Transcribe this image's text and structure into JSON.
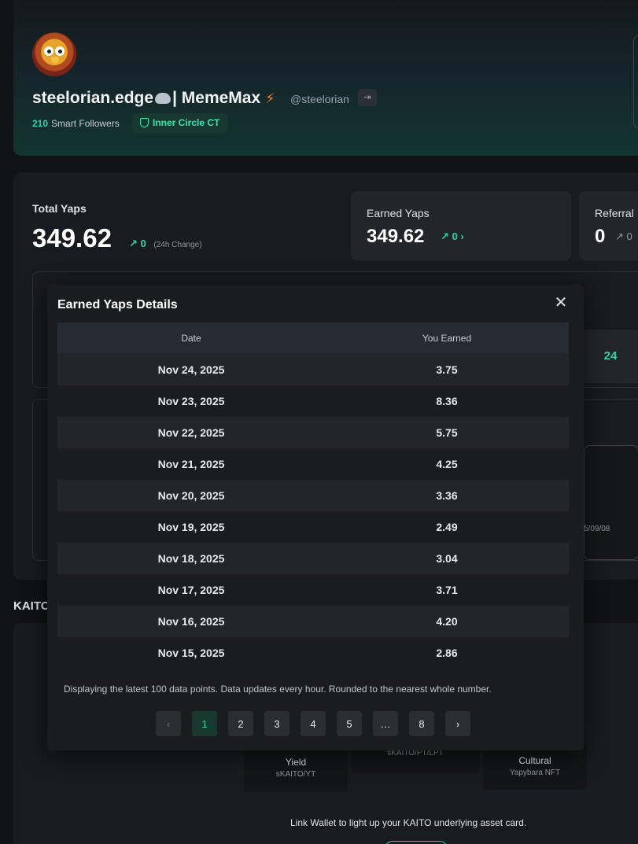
{
  "profile": {
    "display_name": "steelorian.edge",
    "name_suffix": "| MemeMax",
    "handle": "@steelorian",
    "smart_followers_count": "210",
    "smart_followers_label": "Smart Followers",
    "badge": "Inner Circle CT"
  },
  "stats": {
    "total_label": "Total Yaps",
    "total_value": "349.62",
    "total_change": "0",
    "total_change_note": "(24h Change)",
    "earned_label": "Earned Yaps",
    "earned_value": "349.62",
    "earned_change": "0",
    "referral_label": "Referral",
    "referral_value": "0",
    "referral_change": "0",
    "peek_number": "24",
    "peek_date": "5/09/08"
  },
  "kaito": {
    "section_label": "KAITO",
    "tiles": [
      {
        "title": "Yield",
        "subtitle": "sKAITO/YT"
      },
      {
        "title": "",
        "subtitle": "sKAITO/PT/LPT"
      },
      {
        "title": "Cultural",
        "subtitle": "Yapybara NFT"
      }
    ],
    "link_wallet_text": "Link Wallet to light up your KAITO underlying asset card."
  },
  "modal": {
    "title": "Earned Yaps Details",
    "columns": [
      "Date",
      "You Earned"
    ],
    "rows": [
      {
        "date": "Nov 24, 2025",
        "earned": "3.75"
      },
      {
        "date": "Nov 23, 2025",
        "earned": "8.36"
      },
      {
        "date": "Nov 22, 2025",
        "earned": "5.75"
      },
      {
        "date": "Nov 21, 2025",
        "earned": "4.25"
      },
      {
        "date": "Nov 20, 2025",
        "earned": "3.36"
      },
      {
        "date": "Nov 19, 2025",
        "earned": "2.49"
      },
      {
        "date": "Nov 18, 2025",
        "earned": "3.04"
      },
      {
        "date": "Nov 17, 2025",
        "earned": "3.71"
      },
      {
        "date": "Nov 16, 2025",
        "earned": "4.20"
      },
      {
        "date": "Nov 15, 2025",
        "earned": "2.86"
      }
    ],
    "footnote": "Displaying the latest 100 data points. Data updates every hour. Rounded to the nearest whole number.",
    "pagination": {
      "prev": "‹",
      "pages": [
        "1",
        "2",
        "3",
        "4",
        "5",
        "…",
        "8"
      ],
      "active": "1",
      "next": "›"
    }
  },
  "colors": {
    "accent": "#2ed3a3",
    "modal_bg": "#1a1c1f",
    "table_header_bg": "#262b33"
  }
}
